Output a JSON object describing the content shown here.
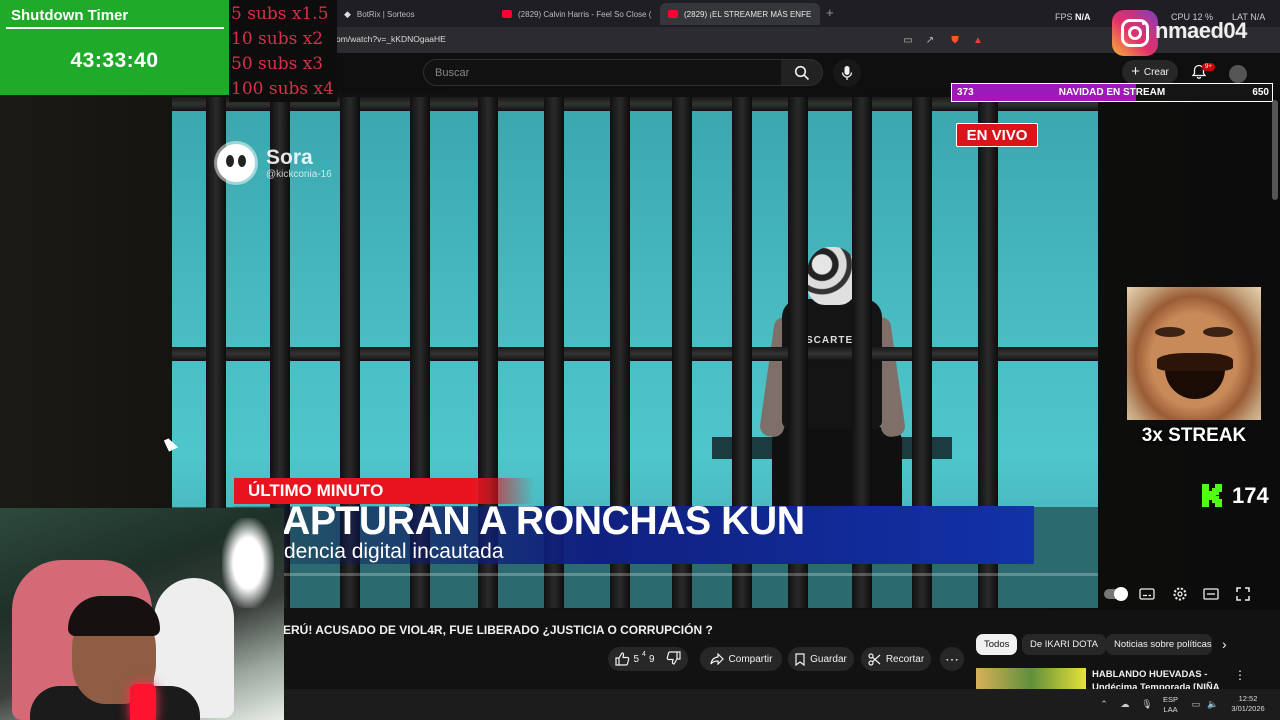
{
  "browser": {
    "tabs": [
      {
        "label": "BotRix | Sorteos",
        "icon": "botrix-icon"
      },
      {
        "label": "(2829) Calvin Harris - Feel So Close (",
        "icon": "youtube-icon"
      },
      {
        "label": "(2829) ¡EL STREAMER MÁS ENFE",
        "icon": "youtube-icon",
        "active": true
      }
    ],
    "url": "om/watch?v=_kKDNOgaaHE",
    "new_tab_symbol": "+",
    "close_symbol": "✕"
  },
  "system_overlay": {
    "fps_label": "FPS",
    "fps_value": "N/A",
    "cpu_label": "CPU",
    "cpu_value": "12 %",
    "lat_label": "LAT",
    "lat_value": "N/A"
  },
  "youtube": {
    "search_placeholder": "Buscar",
    "create_label": "Crear",
    "notification_badge": "9+"
  },
  "stream_overlay": {
    "timer_title": "Shutdown Timer",
    "timer_value": "43:33:40",
    "subs_multipliers": [
      "5 subs x1.5",
      "10 subs x2",
      "50 subs x3",
      "100 subs x4"
    ],
    "instagram_handle": "nmaed04",
    "goal_bar": {
      "current": "373",
      "label": "NAVIDAD EN STREAM",
      "target": "650",
      "fill_fraction": 0.574
    },
    "streak_label": "3x STREAK",
    "kick_viewers": "174",
    "colors": {
      "timer_bg": "#1faa2a",
      "subs_text": "#d5314a",
      "goal_fill": "#9e1ab8",
      "live_red": "#d9141b"
    }
  },
  "video": {
    "live_badge": "EN VIVO",
    "watermark_name": "Sora",
    "watermark_handle": "@kickconia-16",
    "breaking_label": "ÚLTIMO MINUTO",
    "headline": "APTURAN A RONCHAS KUN",
    "subline": "dencia digital incautada",
    "prisoner_shirt_text": "SCARTE"
  },
  "watch": {
    "title": "ERÚ! ACUSADO DE VIOL4R, FUE LIBERADO ¿JUSTICIA O CORRUPCIÓN ?",
    "likes": "5",
    "like_superscript": "4",
    "like_tail": "9",
    "share_label": "Compartir",
    "save_label": "Guardar",
    "clip_label": "Recortar",
    "more_symbol": "⋯"
  },
  "recommendations": {
    "chips": [
      "Todos",
      "De IKARI DOTA",
      "Noticias sobre políticas"
    ],
    "first_item_title": "HABLANDO HUEVADAS -",
    "first_item_subtitle": "Undécima Temporada [NIÑA"
  },
  "taskbar": {
    "language_top": "ESP",
    "language_bottom": "LAA",
    "time": "12:52",
    "date": "3/01/2026"
  }
}
